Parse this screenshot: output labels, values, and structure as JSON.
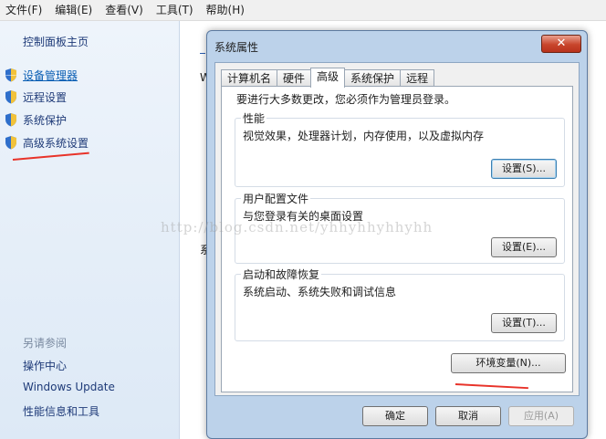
{
  "menu": [
    "文件(F)",
    "编辑(E)",
    "查看(V)",
    "工具(T)",
    "帮助(H)"
  ],
  "sidebar": {
    "home": "控制面板主页",
    "items": [
      {
        "label": "设备管理器",
        "icon": "shield-icon",
        "link": true
      },
      {
        "label": "远程设置",
        "icon": "shield-icon",
        "link": false
      },
      {
        "label": "系统保护",
        "icon": "shield-icon",
        "link": false
      },
      {
        "label": "高级系统设置",
        "icon": "shield-icon",
        "link": false
      }
    ],
    "see_also": "另请参阅",
    "bottom": [
      "操作中心",
      "Windows Update",
      "性能信息和工具"
    ]
  },
  "background_peek": [
    "W",
    "系"
  ],
  "dialog": {
    "title": "系统属性",
    "close": "✕",
    "tabs": [
      "计算机名",
      "硬件",
      "高级",
      "系统保护",
      "远程"
    ],
    "active_tab": "高级",
    "note": "要进行大多数更改，您必须作为管理员登录。",
    "groups": [
      {
        "title": "性能",
        "desc": "视觉效果，处理器计划，内存使用，以及虚拟内存",
        "button": "设置(S)..."
      },
      {
        "title": "用户配置文件",
        "desc": "与您登录有关的桌面设置",
        "button": "设置(E)..."
      },
      {
        "title": "启动和故障恢复",
        "desc": "系统启动、系统失败和调试信息",
        "button": "设置(T)..."
      }
    ],
    "env_button": "环境变量(N)...",
    "ok": "确定",
    "cancel": "取消",
    "apply": "应用(A)"
  },
  "watermark": "http://blog.csdn.net/yhhyhhyhhyhh",
  "colors": {
    "arrow": "#e8332a",
    "link": "#0b5fb4"
  }
}
